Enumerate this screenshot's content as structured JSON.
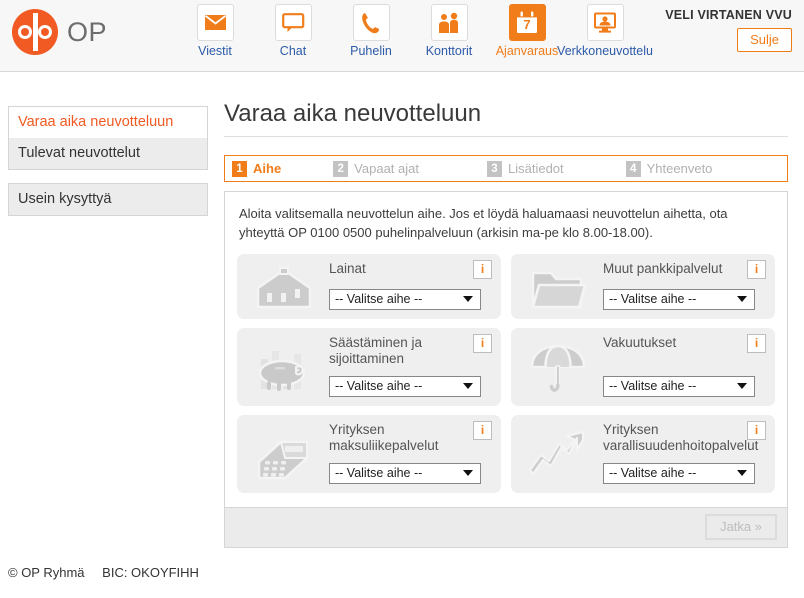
{
  "header": {
    "brand": "OP",
    "brand_icon": "op-logo-icon",
    "nav": [
      {
        "label": "Viestit",
        "icon": "envelope-icon",
        "active": false
      },
      {
        "label": "Chat",
        "icon": "chat-bubble-icon",
        "active": false
      },
      {
        "label": "Puhelin",
        "icon": "phone-icon",
        "active": false
      },
      {
        "label": "Konttorit",
        "icon": "branch-office-icon",
        "active": false
      },
      {
        "label": "Ajanvaraus",
        "icon": "calendar-icon",
        "active": true
      },
      {
        "label": "Verkkoneuvottelu",
        "icon": "video-meeting-icon",
        "active": false
      }
    ],
    "user_name": "VELI VIRTANEN VVU",
    "close_label": "Sulje"
  },
  "sidebar": {
    "groups": [
      {
        "items": [
          {
            "label": "Varaa aika neuvotteluun",
            "active": true
          },
          {
            "label": "Tulevat neuvottelut",
            "active": false
          }
        ]
      },
      {
        "items": [
          {
            "label": "Usein kysyttyä",
            "active": false
          }
        ]
      }
    ]
  },
  "main": {
    "title": "Varaa aika neuvotteluun",
    "steps": [
      {
        "num": "1",
        "label": "Aihe",
        "current": true
      },
      {
        "num": "2",
        "label": "Vapaat ajat",
        "current": false
      },
      {
        "num": "3",
        "label": "Lisätiedot",
        "current": false
      },
      {
        "num": "4",
        "label": "Yhteenveto",
        "current": false
      }
    ],
    "intro": "Aloita valitsemalla neuvottelun aihe. Jos et löydä haluamaasi neuvottelun aihetta, ota yhteyttä OP 0100 0500 puhelinpalveluun (arkisin ma-pe klo 8.00-18.00).",
    "cards": [
      {
        "title": "Lainat",
        "icon": "house-icon",
        "select_value": "-- Valitse aihe --",
        "info_label": "i",
        "tall": false
      },
      {
        "title": "Muut pankkipalvelut",
        "icon": "folder-icon",
        "select_value": "-- Valitse aihe --",
        "info_label": "i",
        "tall": false
      },
      {
        "title": "Säästäminen ja sijoittaminen",
        "icon": "piggy-bank-icon",
        "select_value": "-- Valitse aihe --",
        "info_label": "i",
        "tall": true
      },
      {
        "title": "Vakuutukset",
        "icon": "umbrella-icon",
        "select_value": "-- Valitse aihe --",
        "info_label": "i",
        "tall": true
      },
      {
        "title": "Yrityksen maksuliikepalvelut",
        "icon": "cash-register-icon",
        "select_value": "-- Valitse aihe --",
        "info_label": "i",
        "tall": true
      },
      {
        "title": "Yrityksen varallisuudenhoitopalvelut",
        "icon": "growth-arrow-icon",
        "select_value": "-- Valitse aihe --",
        "info_label": "i",
        "tall": true
      }
    ],
    "continue_label": "Jatka »"
  },
  "footer": {
    "copyright": "© OP Ryhmä",
    "bic": "BIC: OKOYFIHH"
  },
  "colors": {
    "brand_orange": "#f15a22",
    "accent_orange": "#f07d1a",
    "link_blue": "#2c5aa8",
    "card_gray": "#efefef"
  }
}
